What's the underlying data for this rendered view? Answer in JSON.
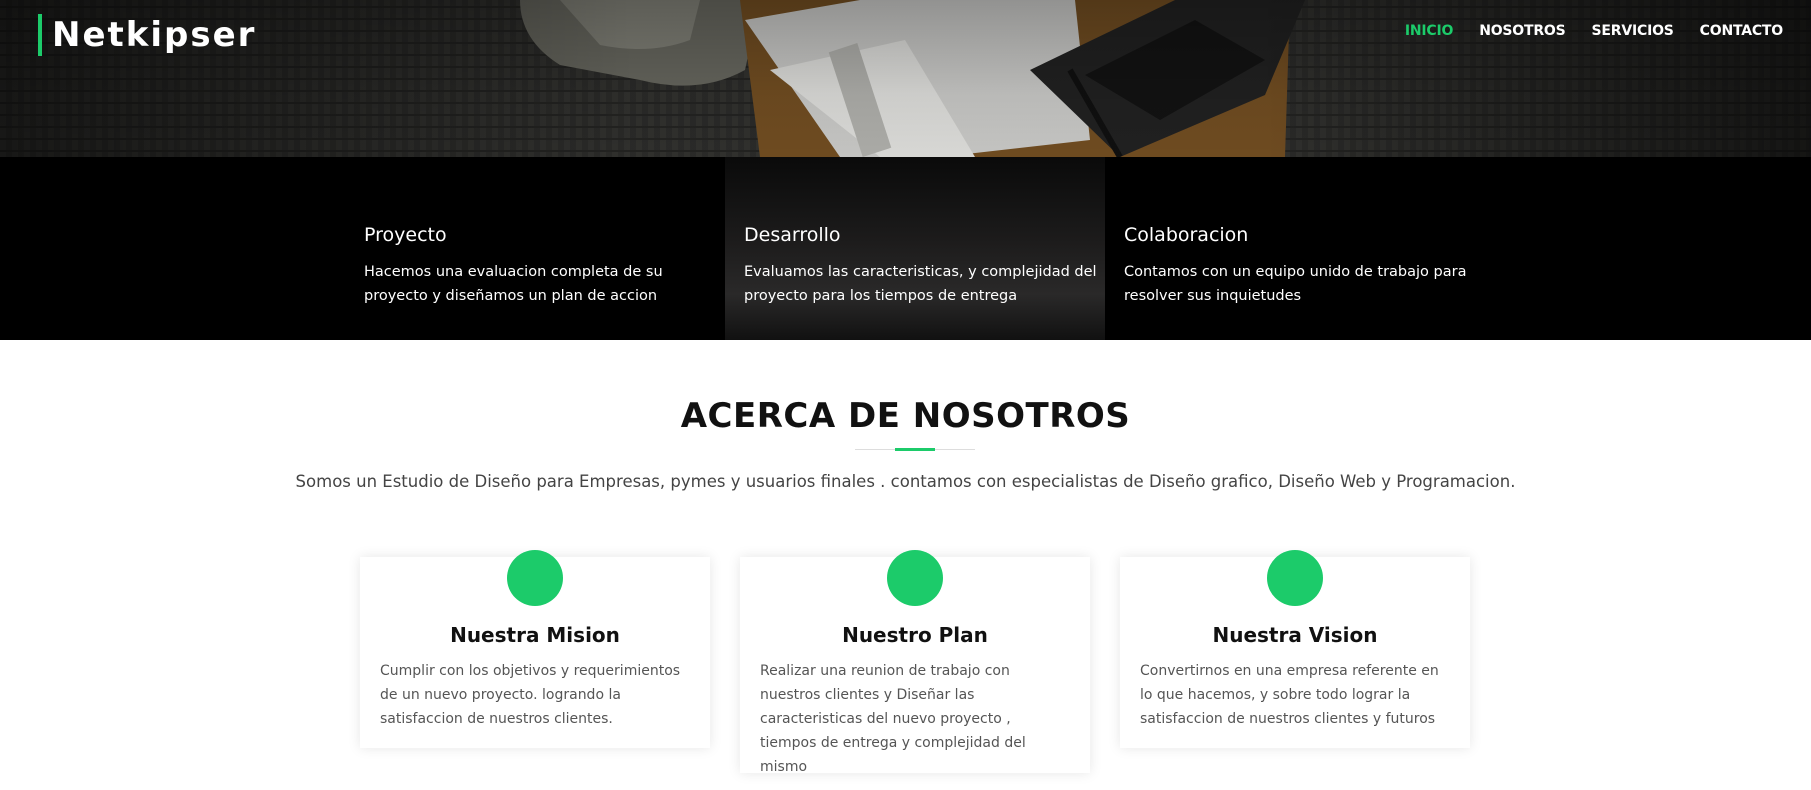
{
  "header": {
    "logo": "Netkipser",
    "nav": [
      "INICIO",
      "NOSOTROS",
      "SERVICIOS",
      "CONTACTO"
    ],
    "active_nav": "INICIO"
  },
  "colors": {
    "accent": "#1ccb6a",
    "dark_strip": "#000000",
    "title": "#111111"
  },
  "features": [
    {
      "title": "Proyecto",
      "text": "Hacemos una evaluacion completa de su proyecto y diseñamos un plan de accion"
    },
    {
      "title": "Desarrollo",
      "text": "Evaluamos las caracteristicas, y complejidad del proyecto para los tiempos de entrega"
    },
    {
      "title": "Colaboracion",
      "text": "Contamos con un equipo unido de trabajo para resolver sus inquietudes"
    }
  ],
  "about": {
    "title": "ACERCA DE NOSOTROS",
    "text": "Somos un Estudio de Diseño para Empresas, pymes y usuarios finales . contamos con especialistas de Diseño grafico, Diseño Web y Programacion."
  },
  "cards": [
    {
      "title": "Nuestra Mision",
      "text": "Cumplir con los objetivos y requerimientos de un nuevo proyecto. logrando la satisfaccion de nuestros clientes."
    },
    {
      "title": "Nuestro Plan",
      "text": "Realizar una reunion de trabajo con nuestros clientes y Diseñar las caracteristicas del nuevo proyecto , tiempos de entrega y complejidad del mismo"
    },
    {
      "title": "Nuestra Vision",
      "text": "Convertirnos en una empresa referente en lo que hacemos, y sobre todo lograr la satisfaccion de nuestros clientes y futuros"
    }
  ]
}
